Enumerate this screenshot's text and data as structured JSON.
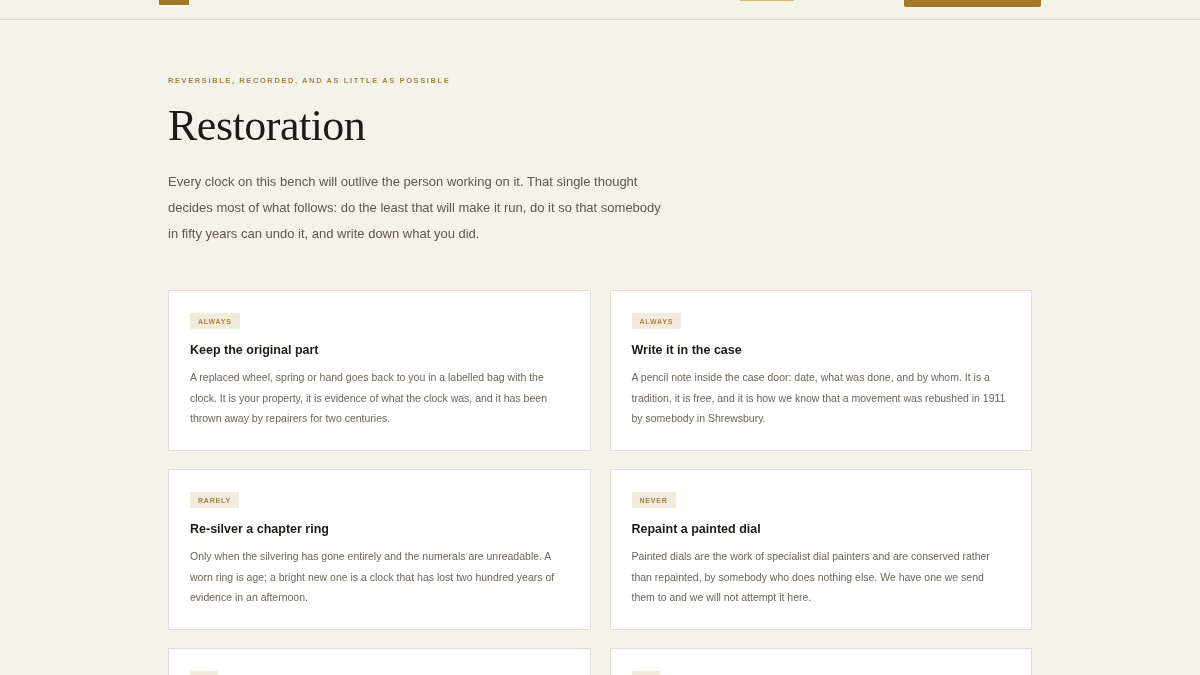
{
  "section": {
    "eyebrow": "REVERSIBLE, RECORDED, AND AS LITTLE AS POSSIBLE",
    "title": "Restoration",
    "intro": "Every clock on this bench will outlive the person working on it. That single thought decides most of what follows: do the least that will make it run, do it so that somebody in fifty years can undo it, and write down what you did."
  },
  "cards": [
    {
      "kind": "full",
      "tag": "ALWAYS",
      "title": "Keep the original part",
      "body": "A replaced wheel, spring or hand goes back to you in a labelled bag with the clock. It is your property, it is evidence of what the clock was, and it has been thrown away by repairers for two centuries."
    },
    {
      "kind": "full",
      "tag": "ALWAYS",
      "title": "Write it in the case",
      "body": "A pencil note inside the case door: date, what was done, and by whom. It is a tradition, it is free, and it is how we know that a movement was rebushed in 1911 by somebody in Shrewsbury."
    },
    {
      "kind": "full",
      "tag": "RARELY",
      "title": "Re-silver a chapter ring",
      "body": "Only when the silvering has gone entirely and the numerals are unreadable. A worn ring is age; a bright new one is a clock that has lost two hundred years of evidence in an afternoon."
    },
    {
      "kind": "full",
      "tag": "NEVER",
      "title": "Repaint a painted dial",
      "body": "Painted dials are the work of specialist dial painters and are conserved rather than repainted, by somebody who does nothing else. We have one we send them to and we will not attempt it here."
    },
    {
      "kind": "cut"
    },
    {
      "kind": "cut"
    }
  ]
}
